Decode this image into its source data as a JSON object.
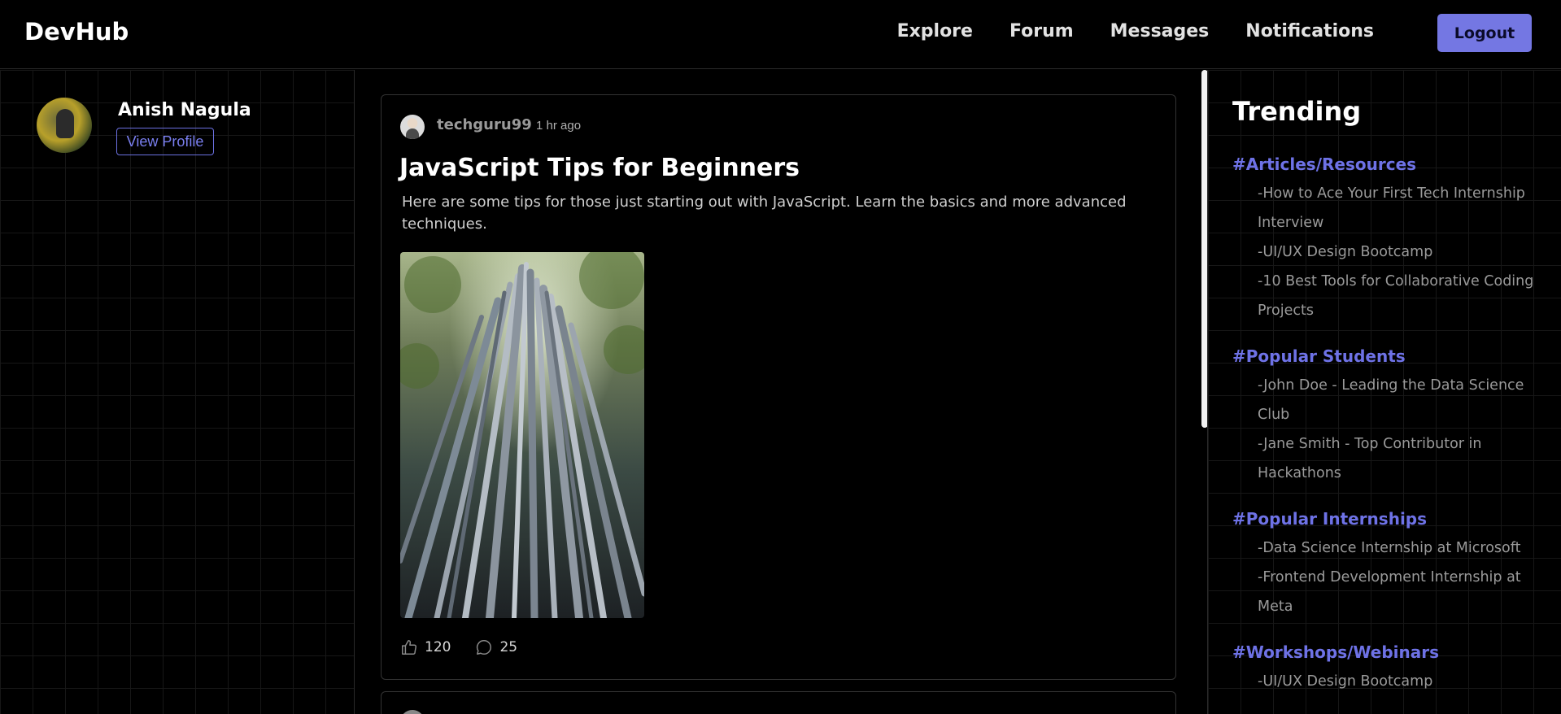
{
  "brand": "DevHub",
  "nav": {
    "links": [
      "Explore",
      "Forum",
      "Messages",
      "Notifications"
    ],
    "logout_label": "Logout"
  },
  "profile": {
    "name": "Anish Nagula",
    "view_profile_label": "View Profile"
  },
  "post": {
    "author": "techguru99",
    "time": "1 hr ago",
    "title": "JavaScript Tips for Beginners",
    "body": "Here are some tips for those just starting out with JavaScript. Learn the basics and more advanced techniques.",
    "likes": "120",
    "comments": "25"
  },
  "trending": {
    "title": "Trending",
    "sections": [
      {
        "heading": "#Articles/Resources",
        "items": [
          "-How to Ace Your First Tech Internship Interview",
          "-UI/UX Design Bootcamp",
          "-10 Best Tools for Collaborative Coding Projects"
        ]
      },
      {
        "heading": "#Popular Students",
        "items": [
          "-John Doe - Leading the Data Science Club",
          "-Jane Smith - Top Contributor in Hackathons"
        ]
      },
      {
        "heading": "#Popular Internships",
        "items": [
          "-Data Science Internship at Microsoft",
          "-Frontend Development Internship at Meta"
        ]
      },
      {
        "heading": "#Workshops/Webinars",
        "items": [
          "-UI/UX Design Bootcamp"
        ]
      }
    ]
  },
  "colors": {
    "accent": "#6e72e6",
    "button_bg": "#7477e3",
    "background": "#000000"
  }
}
